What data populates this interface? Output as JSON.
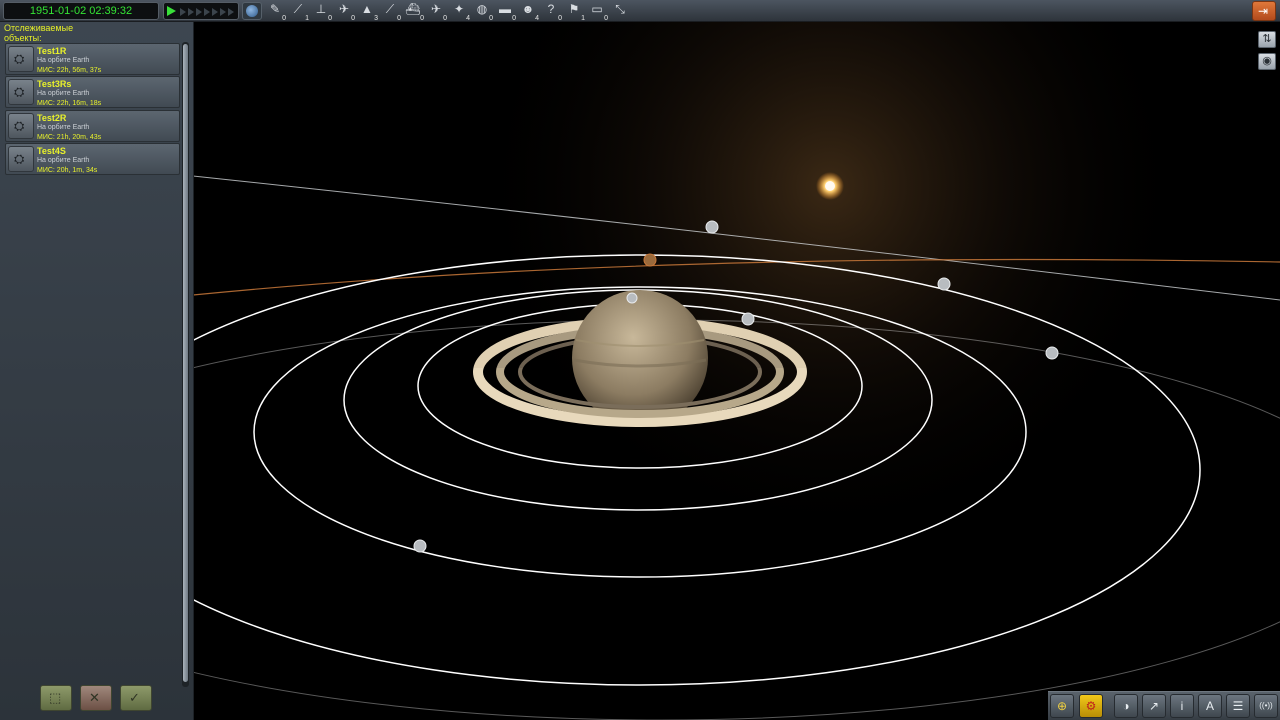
{
  "topbar": {
    "date": "1951-01-02 02:39:32",
    "warp_levels": 7,
    "filter_icons": [
      {
        "icon": "debris-icon",
        "glyph": "✎",
        "count": "0"
      },
      {
        "icon": "unknown-object-icon",
        "glyph": "⟋",
        "count": "1"
      },
      {
        "icon": "spaceobject-icon",
        "glyph": "⊥",
        "count": "0"
      },
      {
        "icon": "probe-icon",
        "glyph": "✈",
        "count": "0"
      },
      {
        "icon": "rover-icon",
        "glyph": "▲",
        "count": "3"
      },
      {
        "icon": "lander-icon",
        "glyph": "⟋",
        "count": "0"
      },
      {
        "icon": "ship-icon",
        "glyph": "⛴",
        "count": "0"
      },
      {
        "icon": "plane-icon",
        "glyph": "✈",
        "count": "0"
      },
      {
        "icon": "relay-icon",
        "glyph": "✦",
        "count": "4"
      },
      {
        "icon": "base-icon",
        "glyph": "◍",
        "count": "0"
      },
      {
        "icon": "station-icon",
        "glyph": "▬",
        "count": "0"
      },
      {
        "icon": "eva-icon",
        "glyph": "☻",
        "count": "4"
      },
      {
        "icon": "flag-icon",
        "glyph": "?",
        "count": "0"
      },
      {
        "icon": "dropped-part-icon",
        "glyph": "⚑",
        "count": "1"
      },
      {
        "icon": "deployed-science-icon",
        "glyph": "▭",
        "count": "0"
      },
      {
        "icon": "expand-filters-icon",
        "glyph": "⤡",
        "count": ""
      }
    ]
  },
  "panel": {
    "header": "Отслеживаемые объекты:",
    "items": [
      {
        "name": "Test1R",
        "status": "На орбите Earth",
        "met": "МИС: 22h, 56m, 37s"
      },
      {
        "name": "Test3Rs",
        "status": "На орбите Earth",
        "met": "МИС: 22h, 16m, 18s"
      },
      {
        "name": "Test2R",
        "status": "На орбите Earth",
        "met": "МИС: 21h, 20m, 43s"
      },
      {
        "name": "Test4S",
        "status": "На орбите Earth",
        "met": "МИС: 20h, 1m, 34s"
      }
    ],
    "buttons": [
      {
        "icon": "fly-icon",
        "glyph": "⬚"
      },
      {
        "icon": "delete-icon",
        "glyph": "✕"
      },
      {
        "icon": "recover-icon",
        "glyph": "✓"
      }
    ]
  },
  "colors": {
    "date_text": "#34e534",
    "tracked_name": "#e9f22a",
    "orbit_line": "#ffffff",
    "planet_orbit_orange": "#c8783a"
  },
  "bottombar": {
    "buttons": [
      {
        "icon": "globe-icon",
        "glyph": "⊕"
      },
      {
        "icon": "contracts-icon",
        "glyph": "⚙"
      },
      {
        "icon": "strategy-icon",
        "glyph": "◑"
      },
      {
        "icon": "maneuver-icon",
        "glyph": "↗"
      },
      {
        "icon": "info-icon",
        "glyph": "i"
      },
      {
        "icon": "kerbnet-icon",
        "glyph": "A"
      },
      {
        "icon": "notes-icon",
        "glyph": "☰"
      },
      {
        "icon": "commnet-icon",
        "glyph": "((•))"
      }
    ]
  }
}
